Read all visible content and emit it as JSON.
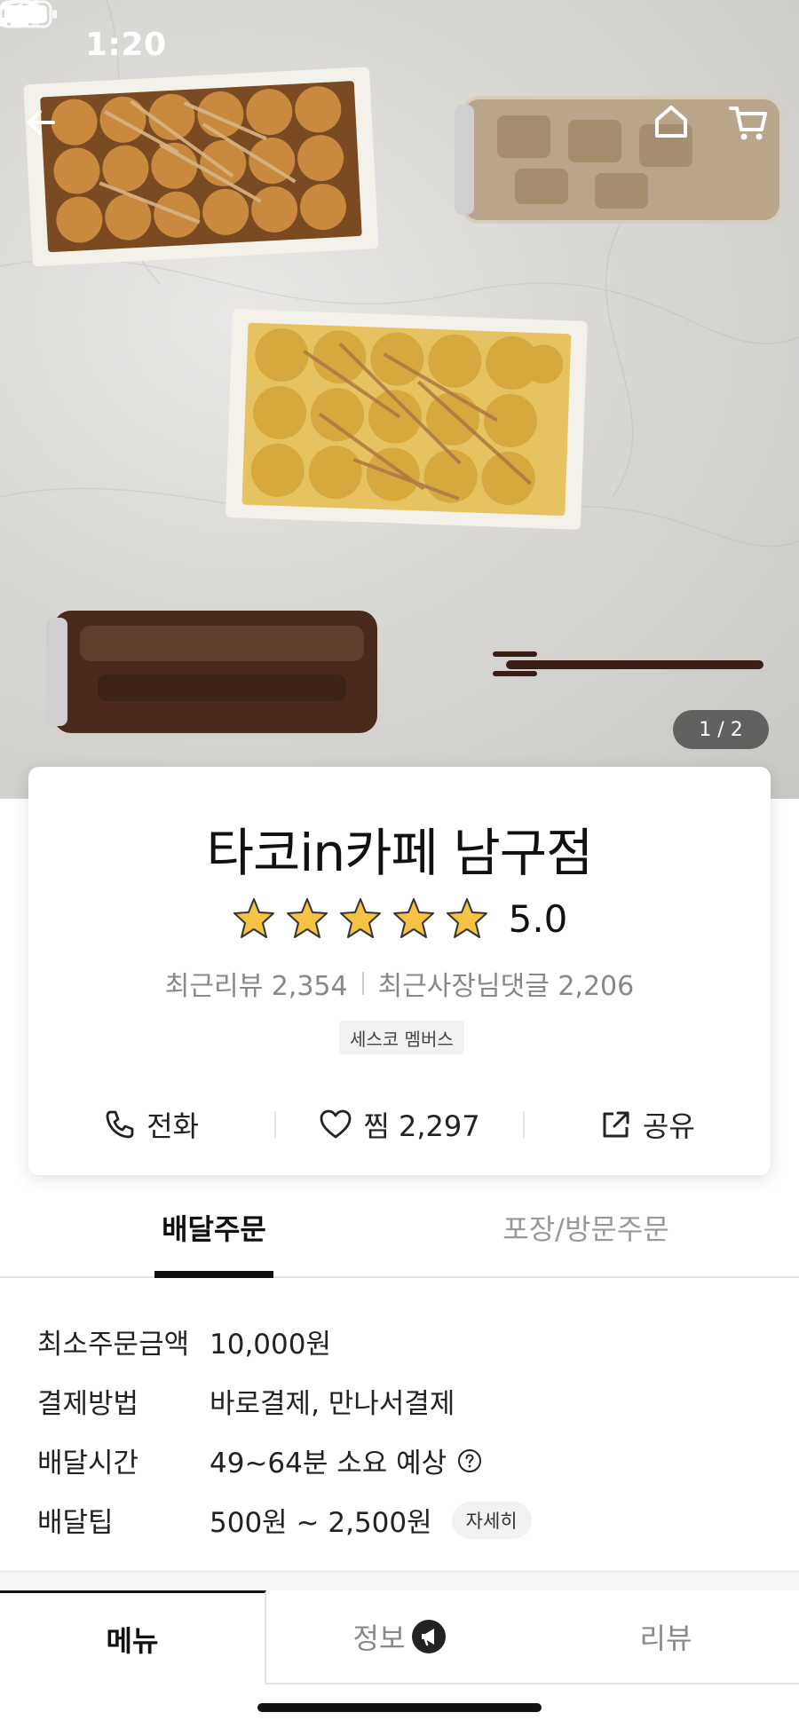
{
  "status_bar": {
    "time": "1:20"
  },
  "hero": {
    "page_counter": "1 / 2"
  },
  "store": {
    "name": "타코in카페 남구점",
    "stars": 5,
    "rating": "5.0",
    "recent_reviews": "최근리뷰 2,354",
    "recent_owner_replies": "최근사장님댓글 2,206",
    "badge": "세스코 멤버스",
    "actions": {
      "call": "전화",
      "favorite": "찜 2,297",
      "share": "공유"
    }
  },
  "order_tabs": {
    "delivery": "배달주문",
    "pickup": "포장/방문주문"
  },
  "info": {
    "rows": [
      {
        "label": "최소주문금액",
        "value": "10,000원"
      },
      {
        "label": "결제방법",
        "value": "바로결제, 만나서결제"
      },
      {
        "label": "배달시간",
        "value": "49~64분 소요 예상"
      },
      {
        "label": "배달팁",
        "value": "500원 ~ 2,500원"
      }
    ],
    "detail_chip": "자세히"
  },
  "main_tabs": {
    "menu": "메뉴",
    "info": "정보",
    "review": "리뷰"
  },
  "colors": {
    "star": "#F6C244",
    "active_text": "#111111",
    "inactive_text": "#999999"
  }
}
